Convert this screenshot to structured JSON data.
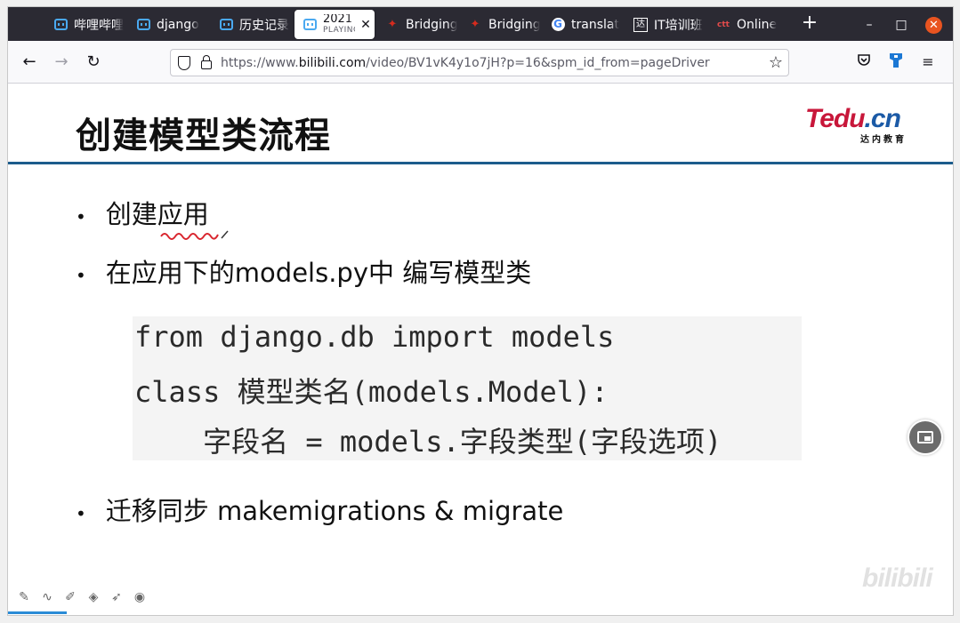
{
  "tabs": [
    {
      "label": "哔哩哔哩",
      "icon": "bilibili-icon"
    },
    {
      "label": "django",
      "icon": "bilibili-icon"
    },
    {
      "label": "历史记录",
      "icon": "bilibili-icon"
    },
    {
      "label": "2021",
      "sub": "PLAYING",
      "icon": "bilibili-icon",
      "active": true
    },
    {
      "label": "Bridging",
      "icon": "maple-leaf-icon"
    },
    {
      "label": "Bridging",
      "icon": "maple-leaf-icon"
    },
    {
      "label": "translat",
      "icon": "google-icon"
    },
    {
      "label": "IT培训班",
      "icon": "da-icon"
    },
    {
      "label": "Online",
      "icon": "ctt-icon"
    }
  ],
  "url": {
    "prefix": "https://www.",
    "domain": "bilibili.com",
    "path": "/video/BV1vK4y1o7jH?p=16&spm_id_from=pageDriver"
  },
  "slide": {
    "title": "创建模型类流程",
    "logo_main_1": "Tedu",
    "logo_main_2": ".cn",
    "logo_sub": "达内教育",
    "bullets": [
      "创建应用",
      "在应用下的models.py中 编写模型类",
      "迁移同步  makemigrations & migrate"
    ],
    "code": [
      "from django.db import models",
      "class 模型类名(models.Model):",
      "    字段名 = models.字段类型(字段选项)"
    ]
  },
  "watermark": "bilibili",
  "colors": {
    "tabbar_bg": "#2b2a33",
    "rule": "#1c5c8c",
    "close_button": "#e95420",
    "annotation": "#d9262f"
  }
}
